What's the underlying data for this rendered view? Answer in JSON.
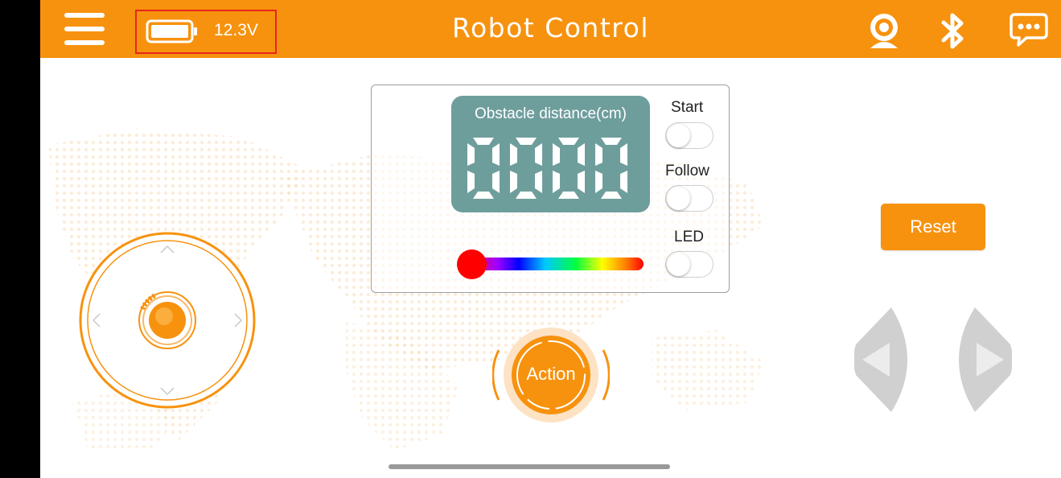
{
  "header": {
    "title": "Robot Control",
    "battery_voltage": "12.3V",
    "icons": [
      "menu-icon",
      "battery-icon",
      "webcam-icon",
      "bluetooth-icon",
      "chat-icon"
    ]
  },
  "panel": {
    "display_label": "Obstacle distance(cm)",
    "distance_value": "0000",
    "switches": [
      {
        "label": "Start",
        "on": false
      },
      {
        "label": "Follow",
        "on": false
      },
      {
        "label": "LED",
        "on": false
      }
    ],
    "color_slider_value": 0
  },
  "action": {
    "label": "Action"
  },
  "reset": {
    "label": "Reset"
  },
  "colors": {
    "accent": "#f7920e",
    "display": "#6e9e9c",
    "arrow_gray": "#d0d0d0",
    "highlight": "#e8251a"
  }
}
